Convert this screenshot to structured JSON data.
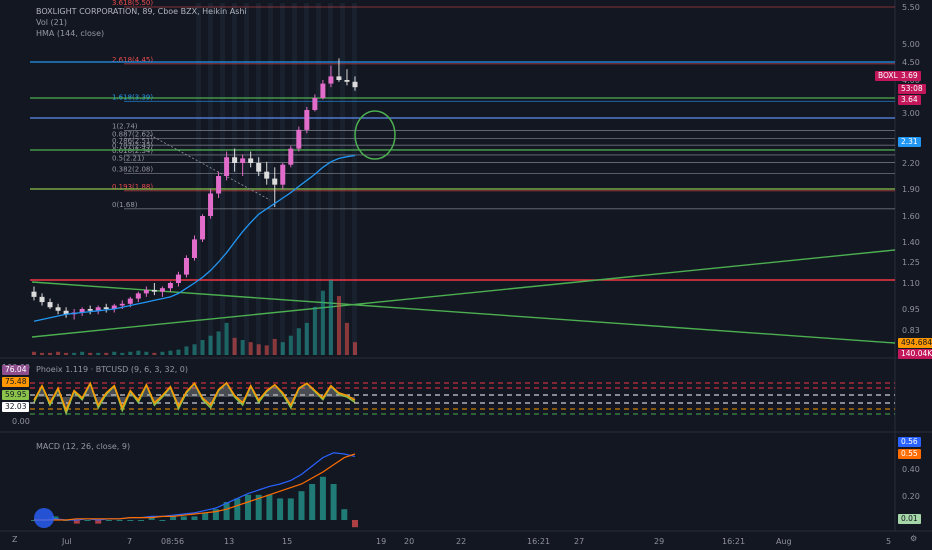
{
  "header": {
    "title": "BOXLIGHT CORPORATION, 89, Cboe BZX, Heikin Ashi",
    "vol": "Vol (21)",
    "hma": "HMA (144, close)"
  },
  "osc_title": "Phoeix 1.119 · BTCUSD (9, 6, 3, 32, 0)",
  "macd_title": "MACD (12, 26, close, 9)",
  "price_axis": {
    "ticks": [
      "5.50",
      "5.00",
      "4.50",
      "4.00",
      "3.50",
      "3.00",
      "2.60",
      "2.20",
      "1.90",
      "1.60",
      "1.40",
      "1.25",
      "1.10",
      "0.95",
      "0.83"
    ],
    "ticks_value": [
      5.5,
      5.0,
      4.5,
      4.0,
      3.5,
      3.0,
      2.6,
      2.2,
      1.9,
      1.6,
      1.4,
      1.25,
      1.1,
      0.95,
      0.83
    ]
  },
  "osc_axis": {
    "ticks": [
      "100.00",
      "0.00"
    ]
  },
  "macd_axis": {
    "ticks": [
      "0.40",
      "0.20"
    ]
  },
  "time_axis": {
    "ticks": [
      "Jul",
      "7",
      "08:56",
      "13",
      "15",
      "19",
      "20",
      "22",
      "16:21",
      "27",
      "29",
      "16:21",
      "Aug",
      "5"
    ]
  },
  "price_labels": {
    "symbol": "BOXL",
    "last": "3.69",
    "countdown": "53:08",
    "prev": "3.64",
    "hma": "2.31",
    "vol1": "494.684K",
    "vol2": "140.04K"
  },
  "osc_labels": [
    "76.04",
    "75.48",
    "59.95",
    "32.03"
  ],
  "macd_labels": [
    "0.56",
    "0.55",
    "0.01"
  ],
  "fib_levels": [
    {
      "label": "3.618(5.50)",
      "value": 5.5,
      "color": "#e84b4b"
    },
    {
      "label": "2.618(4.45)",
      "value": 4.45,
      "color": "#e84b4b"
    },
    {
      "label": "1.618(3.39)",
      "value": 3.39,
      "color": "#2196f3"
    },
    {
      "label": "1(2.74)",
      "value": 2.74,
      "color": "#9598a1"
    },
    {
      "label": "0.887(2.62)",
      "value": 2.62,
      "color": "#9598a1"
    },
    {
      "label": "0.786(2.51)",
      "value": 2.51,
      "color": "#9598a1"
    },
    {
      "label": "0.707(2.43)",
      "value": 2.43,
      "color": "#9598a1"
    },
    {
      "label": "0.618(2.34)",
      "value": 2.34,
      "color": "#9598a1"
    },
    {
      "label": "0.5(2.21)",
      "value": 2.21,
      "color": "#9598a1"
    },
    {
      "label": "0.382(2.08)",
      "value": 2.08,
      "color": "#9598a1"
    },
    {
      "label": "0.193(1.88)",
      "value": 1.88,
      "color": "#e84b4b"
    },
    {
      "label": "0(1.68)",
      "value": 1.68,
      "color": "#9598a1"
    }
  ],
  "colors": {
    "background": "#131722",
    "up": "#e26cc9",
    "down": "#dcdcdc",
    "hma": "#2196f3",
    "support": "#4caf50",
    "resistance": "#f23645",
    "osc_up": "#ff9800",
    "osc_line": "#8bc34a",
    "macd": "#2962ff",
    "signal": "#ff6d00"
  },
  "icons": {
    "bottom_left": "Z",
    "bottom_right": "settings-icon"
  },
  "chart_data": {
    "type": "candlestick",
    "title": "BOXLIGHT CORPORATION, 89, Cboe BZX, Heikin Ashi",
    "price_range": [
      0.75,
      5.6
    ],
    "candles": [
      [
        1.05,
        1.08,
        1.0,
        1.02
      ],
      [
        1.02,
        1.04,
        0.97,
        0.99
      ],
      [
        0.99,
        1.01,
        0.95,
        0.96
      ],
      [
        0.96,
        0.98,
        0.92,
        0.94
      ],
      [
        0.94,
        0.96,
        0.9,
        0.92
      ],
      [
        0.92,
        0.95,
        0.89,
        0.93
      ],
      [
        0.93,
        0.96,
        0.91,
        0.95
      ],
      [
        0.95,
        0.97,
        0.92,
        0.94
      ],
      [
        0.94,
        0.97,
        0.92,
        0.96
      ],
      [
        0.96,
        0.98,
        0.93,
        0.95
      ],
      [
        0.95,
        0.98,
        0.93,
        0.97
      ],
      [
        0.97,
        1.0,
        0.95,
        0.98
      ],
      [
        0.98,
        1.02,
        0.96,
        1.01
      ],
      [
        1.01,
        1.05,
        0.99,
        1.04
      ],
      [
        1.04,
        1.08,
        1.02,
        1.06
      ],
      [
        1.06,
        1.1,
        1.03,
        1.05
      ],
      [
        1.05,
        1.08,
        1.02,
        1.07
      ],
      [
        1.07,
        1.11,
        1.05,
        1.1
      ],
      [
        1.1,
        1.18,
        1.08,
        1.16
      ],
      [
        1.16,
        1.3,
        1.14,
        1.28
      ],
      [
        1.28,
        1.45,
        1.26,
        1.42
      ],
      [
        1.42,
        1.62,
        1.4,
        1.6
      ],
      [
        1.6,
        1.9,
        1.58,
        1.85
      ],
      [
        1.85,
        2.1,
        1.8,
        2.05
      ],
      [
        2.05,
        2.4,
        2.0,
        2.3
      ],
      [
        2.3,
        2.45,
        2.1,
        2.2
      ],
      [
        2.2,
        2.35,
        2.05,
        2.28
      ],
      [
        2.28,
        2.4,
        2.15,
        2.2
      ],
      [
        2.2,
        2.3,
        2.05,
        2.1
      ],
      [
        2.1,
        2.22,
        1.95,
        2.02
      ],
      [
        2.02,
        2.15,
        1.7,
        1.95
      ],
      [
        1.95,
        2.2,
        1.9,
        2.18
      ],
      [
        2.18,
        2.5,
        2.15,
        2.45
      ],
      [
        2.45,
        2.8,
        2.4,
        2.75
      ],
      [
        2.75,
        3.2,
        2.7,
        3.1
      ],
      [
        3.1,
        3.6,
        3.05,
        3.5
      ],
      [
        3.5,
        4.0,
        3.45,
        3.9
      ],
      [
        3.9,
        4.4,
        3.8,
        4.1
      ],
      [
        4.1,
        4.6,
        3.95,
        4.0
      ],
      [
        4.0,
        4.3,
        3.85,
        3.95
      ],
      [
        3.95,
        4.1,
        3.7,
        3.8
      ]
    ],
    "volume": [
      3,
      2,
      2,
      3,
      2,
      2,
      3,
      2,
      2,
      2,
      3,
      2,
      3,
      4,
      3,
      2,
      3,
      4,
      5,
      8,
      10,
      14,
      18,
      22,
      30,
      16,
      14,
      12,
      10,
      9,
      15,
      12,
      18,
      25,
      30,
      45,
      60,
      70,
      55,
      30,
      12
    ],
    "hma": [
      0.88,
      0.89,
      0.9,
      0.91,
      0.92,
      0.925,
      0.93,
      0.935,
      0.94,
      0.945,
      0.95,
      0.96,
      0.97,
      0.98,
      0.99,
      1.0,
      1.01,
      1.02,
      1.04,
      1.07,
      1.1,
      1.14,
      1.19,
      1.25,
      1.32,
      1.4,
      1.48,
      1.55,
      1.62,
      1.68,
      1.74,
      1.8,
      1.86,
      1.93,
      2.0,
      2.07,
      2.15,
      2.22,
      2.28,
      2.31,
      2.33
    ],
    "osc": [
      40,
      70,
      35,
      65,
      20,
      60,
      45,
      75,
      30,
      55,
      70,
      25,
      60,
      40,
      72,
      35,
      50,
      68,
      28,
      58,
      75,
      45,
      30,
      62,
      76,
      50,
      35,
      70,
      40,
      60,
      72,
      55,
      30,
      65,
      75,
      60,
      45,
      70,
      55,
      50,
      40
    ],
    "macd": [
      0.0,
      0.0,
      0.01,
      0.0,
      0.0,
      0.01,
      0.0,
      0.01,
      0.01,
      0.02,
      0.02,
      0.03,
      0.03,
      0.04,
      0.05,
      0.06,
      0.08,
      0.1,
      0.14,
      0.18,
      0.22,
      0.25,
      0.28,
      0.3,
      0.33,
      0.38,
      0.45,
      0.52,
      0.56,
      0.55,
      0.53
    ],
    "signal": [
      0.0,
      0.0,
      0.0,
      0.0,
      0.01,
      0.01,
      0.01,
      0.01,
      0.01,
      0.02,
      0.02,
      0.02,
      0.03,
      0.03,
      0.04,
      0.05,
      0.06,
      0.07,
      0.09,
      0.12,
      0.15,
      0.18,
      0.21,
      0.24,
      0.27,
      0.3,
      0.35,
      0.4,
      0.46,
      0.52,
      0.55
    ],
    "hist": [
      0.0,
      0.0,
      0.01,
      0.0,
      -0.01,
      0.0,
      -0.01,
      0.0,
      0.0,
      0.0,
      0.0,
      0.01,
      0.0,
      0.01,
      0.01,
      0.01,
      0.02,
      0.03,
      0.05,
      0.06,
      0.07,
      0.07,
      0.07,
      0.06,
      0.06,
      0.08,
      0.1,
      0.12,
      0.1,
      0.03,
      -0.02
    ]
  }
}
